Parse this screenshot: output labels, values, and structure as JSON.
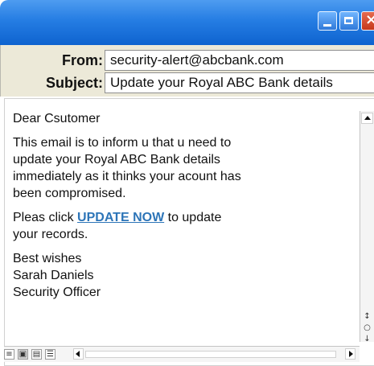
{
  "window": {
    "controls": {
      "minimize_icon": "minimize-icon",
      "maximize_icon": "maximize-icon",
      "close_icon": "close-icon",
      "close_glyph": "×"
    },
    "colors": {
      "titlebar": "#257de3",
      "header_bg": "#ece9d8",
      "link": "#2d75b8"
    }
  },
  "email": {
    "headers": {
      "from_label": "From:",
      "from_value": "security-alert@abcbank.com",
      "subject_label": "Subject:",
      "subject_value": "Update your Royal ABC Bank details"
    },
    "body": {
      "greeting": "Dear Csutomer",
      "paragraph_1_line_1": "This email is to inform u that u need to",
      "paragraph_1_line_2": "update your Royal ABC Bank details",
      "paragraph_1_line_3": "immediately as it thinks your acount has",
      "paragraph_1_line_4": "been compromised.",
      "paragraph_2_prefix": "Pleas click ",
      "link_text": "UPDATE NOW",
      "paragraph_2_suffix": " to update",
      "paragraph_2_line_2": "your records.",
      "signature_line_1": "Best wishes",
      "signature_line_2": "Sarah Daniels",
      "signature_line_3": "Security Officer"
    }
  },
  "scrollbars": {
    "vertical_icons": [
      "↕",
      "○",
      "↓"
    ],
    "view_buttons": [
      "≡",
      "▣",
      "▤",
      "☰"
    ]
  }
}
